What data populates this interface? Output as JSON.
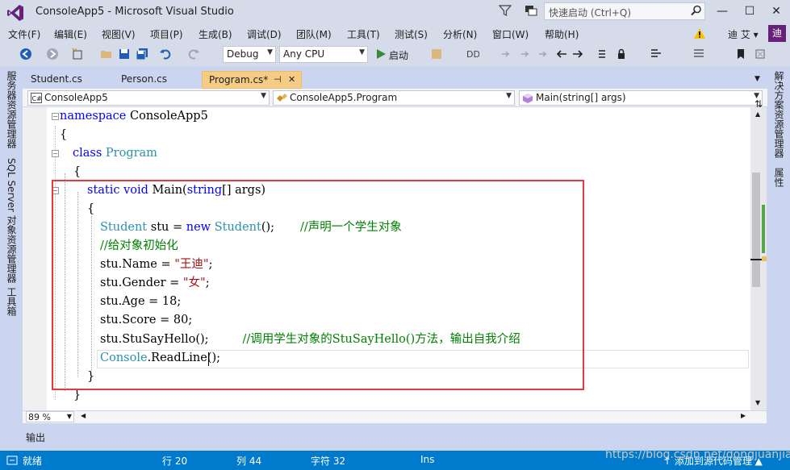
{
  "window": {
    "title": "ConsoleApp5 - Microsoft Visual Studio",
    "quick_launch_placeholder": "快速启动 (Ctrl+Q)",
    "minimize": "—",
    "maximize": "☐",
    "close": "✕"
  },
  "menu": [
    "文件(F)",
    "编辑(E)",
    "视图(V)",
    "项目(P)",
    "生成(B)",
    "调试(D)",
    "团队(M)",
    "工具(T)",
    "测试(S)",
    "分析(N)",
    "窗口(W)",
    "帮助(H)"
  ],
  "user": {
    "name": "迪 艾 ▾",
    "initial": "迪"
  },
  "toolbar": {
    "config": "Debug",
    "platform": "Any CPU",
    "start": "启动"
  },
  "left_sidebar": [
    "服务器资源管理器",
    "SQL Server 对象资源管理器",
    "工具箱"
  ],
  "right_sidebar": [
    "解决方案资源管理器",
    "属性"
  ],
  "tabs": [
    {
      "label": "Student.cs"
    },
    {
      "label": "Person.cs"
    },
    {
      "label": "Program.cs*",
      "pin": "⊣",
      "close": "✕"
    }
  ],
  "nav": {
    "project": "ConsoleApp5",
    "class": "ConsoleApp5.Program",
    "member": "Main(string[] args)"
  },
  "code": {
    "l1_kw": "namespace",
    "l1_rest": " ConsoleApp5",
    "l2": "{",
    "l3_kw": "class",
    "l3_ty": "Program",
    "l4": "{",
    "l5_kw1": "static",
    "l5_kw2": "void",
    "l5_name": " Main(",
    "l5_kw3": "string",
    "l5_rest": "[] args)",
    "l6": "{",
    "l7_ty1": "Student",
    "l7_mid": " stu = ",
    "l7_kw": "new",
    "l7_ty2": "Student",
    "l7_end": "();",
    "l7_cm": "//声明一个学生对象",
    "l8_cm": "//给对象初始化",
    "l9_a": "stu.Name = ",
    "l9_s": "\"王迪\"",
    "l9_e": ";",
    "l10_a": "stu.Gender = ",
    "l10_s": "\"女\"",
    "l10_e": ";",
    "l11": "stu.Age = 18;",
    "l12": "stu.Score = 80;",
    "l13_a": "stu.StuSayHello();",
    "l13_cm": "//调用学生对象的StuSayHello()方法，输出自我介绍",
    "l14_ty": "Console",
    "l14_rest": ".ReadLine();",
    "l15": "}",
    "l16": "}"
  },
  "zoom": "89 %",
  "output_label": "输出",
  "status": {
    "ready": "就绪",
    "line": "行 20",
    "col": "列 44",
    "char": "字符 32",
    "ins": "Ins",
    "add_source": "↑ 添加到源代码管理 ▲"
  },
  "watermark": "https://blog.csdn.net/dongjuanjian",
  "colors": {
    "accent": "#007acc",
    "chrome": "#d6dbe9",
    "active_tab": "#f5cc84",
    "highlight_box": "#e83a3a"
  }
}
